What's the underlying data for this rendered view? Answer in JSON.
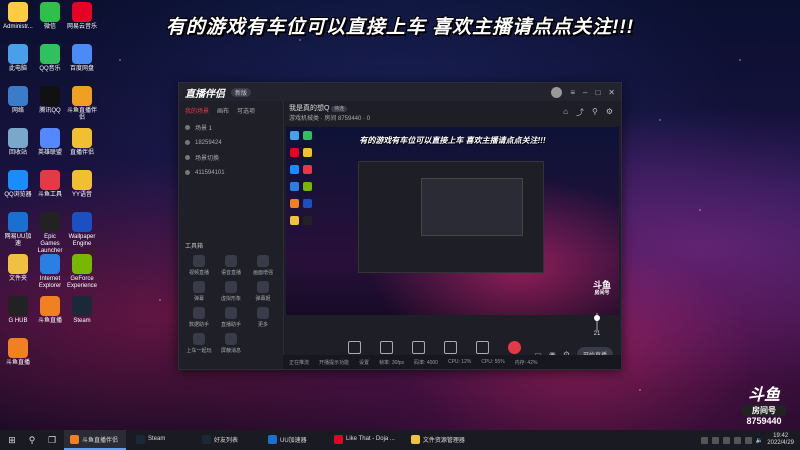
{
  "banner": "有的游戏有车位可以直接上车 喜欢主播请点点关注!!!",
  "desktop_icons": [
    {
      "label": "Administr...",
      "color": "#ffcc44"
    },
    {
      "label": "微信",
      "color": "#2ec04a"
    },
    {
      "label": "网易云音乐",
      "color": "#e60026"
    },
    {
      "label": "此电脑",
      "color": "#4aa0e8"
    },
    {
      "label": "QQ音乐",
      "color": "#30c060"
    },
    {
      "label": "百度网盘",
      "color": "#4a8bf5"
    },
    {
      "label": "网络",
      "color": "#3a7cc8"
    },
    {
      "label": "腾讯QQ",
      "color": "#111111"
    },
    {
      "label": "斗鱼直播伴侣",
      "color": "#f0a020"
    },
    {
      "label": "回收站",
      "color": "#7aa8c8"
    },
    {
      "label": "英雄联盟",
      "color": "#5588ff"
    },
    {
      "label": "直播伴侣",
      "color": "#f0c030"
    },
    {
      "label": "QQ浏览器",
      "color": "#1a8cff"
    },
    {
      "label": "斗鱼工具",
      "color": "#e63946"
    },
    {
      "label": "YY语音",
      "color": "#f0c030"
    },
    {
      "label": "网易UU加速",
      "color": "#1a70d0"
    },
    {
      "label": "Epic Games Launcher",
      "color": "#222222"
    },
    {
      "label": "Wallpaper Engine",
      "color": "#1a50c0"
    },
    {
      "label": "文件夹",
      "color": "#f0c040"
    },
    {
      "label": "Internet Explorer",
      "color": "#2a80e0"
    },
    {
      "label": "GeForce Experience",
      "color": "#76b900"
    },
    {
      "label": "G HUB",
      "color": "#222222"
    },
    {
      "label": "斗鱼直播",
      "color": "#f08020"
    },
    {
      "label": "Steam",
      "color": "#1b2838"
    },
    {
      "label": "斗鱼直播",
      "color": "#f08020"
    }
  ],
  "app": {
    "name": "直播伴侣",
    "version": "新版",
    "left_tabs": [
      "我的场景",
      "画布",
      "可选项"
    ],
    "scenes": [
      "场景 1",
      "18259424",
      "场景切换",
      "411594101"
    ],
    "tools_title": "工具箱",
    "tools": [
      "视频直播",
      "语音直播",
      "画面增强",
      "弹幕",
      "虚拟形象",
      "弹幕姬",
      "数据助手",
      "直播助手",
      "更多",
      "上车一起玩",
      "屏蔽消息"
    ],
    "room_title": "我是真的想Q",
    "room_badge": "待连",
    "room_meta": "游戏机械类 · 房间 8759440 · 0",
    "preview_banner": "有的游戏有车位可以直接上车 喜欢主播请点点关注!!!",
    "preview_logo": "斗鱼",
    "preview_logo_sub": "房间号",
    "volume": "21",
    "controls": [
      "直播屏幕",
      "摄像头",
      "手机投屏",
      "多媒体",
      "麦克风",
      "音频"
    ],
    "go_live": "开始直播",
    "status": [
      "正在推流",
      "开播提示功能",
      "设置",
      "帧率: 30fps",
      "码率: 4000",
      "CPU: 12%",
      "CPU: 55%",
      "内存: 42%"
    ]
  },
  "overlay": {
    "brand": "斗鱼",
    "label": "房间号",
    "room": "8759440"
  },
  "taskbar": {
    "apps": [
      {
        "label": "斗鱼直播伴侣",
        "color": "#f08020",
        "active": true
      },
      {
        "label": "Steam",
        "color": "#1b2838",
        "active": false
      },
      {
        "label": "好友列表",
        "color": "#1b2838",
        "active": false
      },
      {
        "label": "UU加速器",
        "color": "#1a70d0",
        "active": false
      },
      {
        "label": "Like That - Doja ...",
        "color": "#e60026",
        "active": false
      },
      {
        "label": "文件资源管理器",
        "color": "#f0c040",
        "active": false
      }
    ],
    "time": "19:42",
    "date": "2022/4/29"
  }
}
